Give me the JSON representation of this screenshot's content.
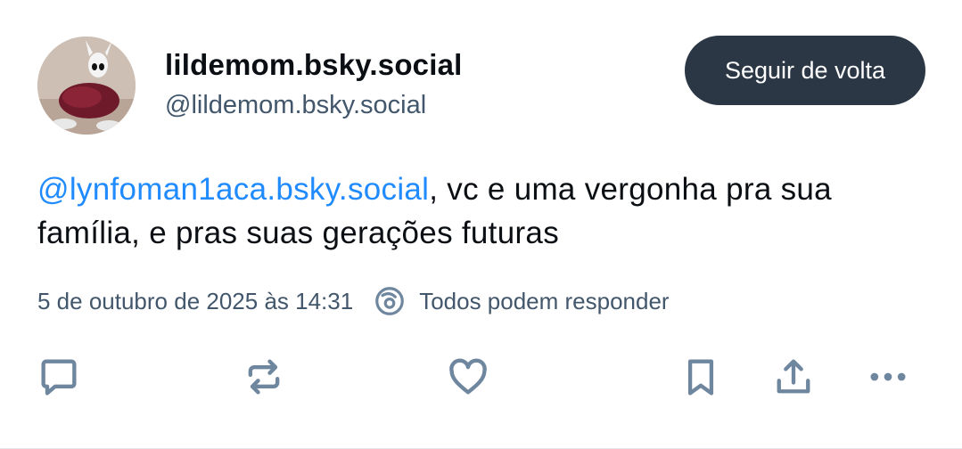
{
  "post": {
    "author": {
      "display_name": "lildemom.bsky.social",
      "handle": "@lildemom.bsky.social",
      "avatar_alt": "avatar"
    },
    "follow_button_label": "Seguir de volta",
    "text": {
      "mention": "@lynfoman1aca.bsky.social",
      "body": ", vc e uma vergonha pra sua família, e pras suas gerações futuras"
    },
    "timestamp": "5 de outubro de 2025 às 14:31",
    "reply_setting": "Todos podem responder"
  },
  "actions": [
    {
      "name": "reply-icon"
    },
    {
      "name": "repost-icon"
    },
    {
      "name": "like-icon"
    },
    {
      "name": "bookmark-icon"
    },
    {
      "name": "share-icon"
    },
    {
      "name": "more-icon"
    }
  ],
  "colors": {
    "mention": "#208bfe",
    "follow_button": "#2b3745",
    "muted_text": "#42576c",
    "icon": "#6f869f"
  }
}
